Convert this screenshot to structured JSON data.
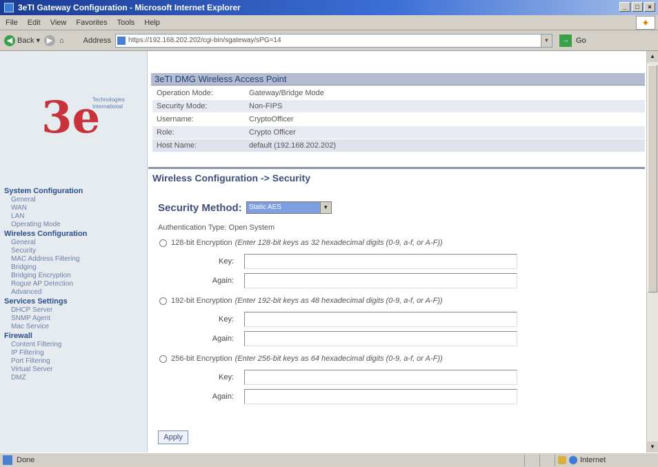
{
  "window": {
    "title": "3eTI Gateway Configuration - Microsoft Internet Explorer"
  },
  "menu": [
    "File",
    "Edit",
    "View",
    "Favorites",
    "Tools",
    "Help"
  ],
  "toolbar": {
    "back_label": "Back",
    "address_label": "Address",
    "url": "https://192.168.202.202/cgi-bin/sgateway/sPG=14",
    "go_label": "Go"
  },
  "sidebar": {
    "logo": {
      "mark": "3e",
      "text": "Technologies International"
    },
    "sections": [
      {
        "title": "System Configuration",
        "items": [
          "General",
          "WAN",
          "LAN",
          "Operating Mode"
        ]
      },
      {
        "title": "Wireless Configuration",
        "items": [
          "General",
          "Security",
          "MAC Address Filtering",
          "Bridging",
          "Bridging Encryption",
          "Rogue AP Detection",
          "Advanced"
        ]
      },
      {
        "title": "Services Settings",
        "items": [
          "DHCP Server",
          "SNMP Agent",
          "Mac Service"
        ]
      },
      {
        "title": "Firewall",
        "items": [
          "Content Filtering",
          "IP Filtering",
          "Port Filtering",
          "Virtual Server",
          "DMZ"
        ]
      }
    ]
  },
  "header": {
    "title": "3eTI DMG Wireless Access Point",
    "rows": [
      {
        "label": "Operation Mode:",
        "value": "Gateway/Bridge Mode"
      },
      {
        "label": "Security Mode:",
        "value": "Non-FIPS"
      },
      {
        "label": "Username:",
        "value": "CryptoOfficer"
      },
      {
        "label": "Role:",
        "value": "Crypto Officer"
      },
      {
        "label": "Host Name:",
        "value": "default (192.168.202.202)"
      }
    ]
  },
  "page": {
    "heading": "Wireless Configuration -> Security",
    "method_label": "Security Method:",
    "method_value": "Static AES",
    "auth_type": "Authentication Type: Open System",
    "options": [
      {
        "label": "128-bit Encryption",
        "hint": "(Enter 128-bit keys as 32 hexadecimal digits (0-9, a-f, or A-F))",
        "key_label": "Key:",
        "again_label": "Again:"
      },
      {
        "label": "192-bit Encryption",
        "hint": "(Enter 192-bit keys as 48 hexadecimal digits (0-9, a-f, or A-F))",
        "key_label": "Key:",
        "again_label": "Again:"
      },
      {
        "label": "256-bit Encryption",
        "hint": "(Enter 256-bit keys as 64 hexadecimal digits (0-9, a-f, or A-F))",
        "key_label": "Key:",
        "again_label": "Again:"
      }
    ],
    "apply_label": "Apply"
  },
  "status": {
    "left": "Done",
    "zone": "Internet"
  }
}
